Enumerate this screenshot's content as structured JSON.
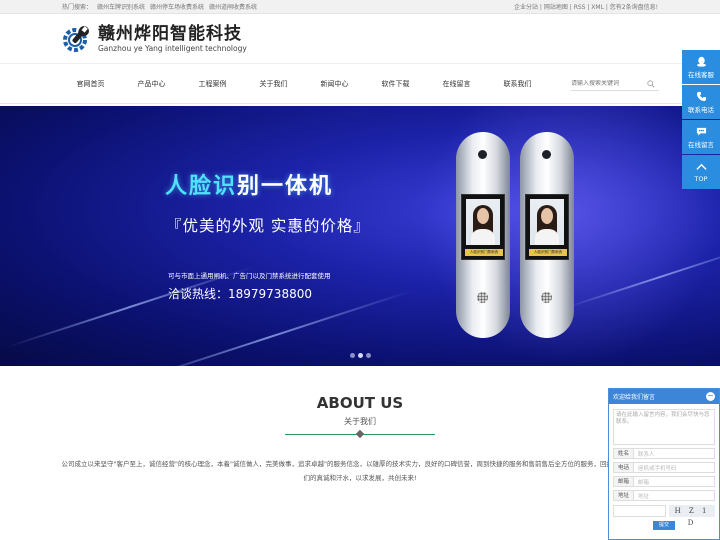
{
  "topbar": {
    "hot_label": "热门搜索：",
    "hot_links": [
      "赣州车牌识别系统",
      "赣州停车场收费系统",
      "赣州道闸收费系统"
    ],
    "right_links": "企业分站 | 网站地图 | RSS | XML | 您有2条询盘信息!"
  },
  "logo": {
    "cn": "赣州烨阳智能科技",
    "en": "Ganzhou ye Yang intelligent technology"
  },
  "nav": {
    "items": [
      "官网首页",
      "产品中心",
      "工程案例",
      "关于我们",
      "新闻中心",
      "软件下载",
      "在线留言",
      "联系我们"
    ],
    "search_placeholder": "请输入搜索关键词"
  },
  "banner": {
    "title_part1": "人脸识",
    "title_part2": "别一体机",
    "slogan": "『优美的外观 实惠的价格』",
    "desc": "可与市面上通用闸机、广告门以及门禁系统进行配套使用",
    "hotline": "洽谈热线：18979738800",
    "device_caption": "人脸识别门禁系统",
    "slide_count": 3,
    "active_slide": 1
  },
  "about": {
    "title": "ABOUT US",
    "subtitle": "关于我们",
    "text": "公司成立以来坚守\"客户至上，诚信经营\"的核心理念，本着\"诚信做人，完美做事，追求卓越\"的服务信念，以雄厚的技术实力，良好的口碑信誉，周到快捷的服务和售前售后全方位的服务，回报每一位客户对我们的真诚和汗水，以求发展，共创未来!"
  },
  "float_bar": {
    "items": [
      {
        "label": "在线客服",
        "icon": "qq-icon"
      },
      {
        "label": "联系电话",
        "icon": "phone-icon"
      },
      {
        "label": "在线留言",
        "icon": "chat-icon"
      },
      {
        "label": "TOP",
        "icon": "arrow-up-icon"
      }
    ],
    "color": "#2a8de0"
  },
  "message_box": {
    "title": "欢迎给我们留言",
    "content_placeholder": "请在此输入留言内容，我们会尽快与您联系。",
    "fields": [
      {
        "label": "姓名",
        "placeholder": "联系人"
      },
      {
        "label": "电话",
        "placeholder": "座机或手机号码"
      },
      {
        "label": "邮箱",
        "placeholder": "邮箱"
      },
      {
        "label": "地址",
        "placeholder": "地址"
      }
    ],
    "captcha_text": "H Z 1 D",
    "submit_label": "提交"
  }
}
